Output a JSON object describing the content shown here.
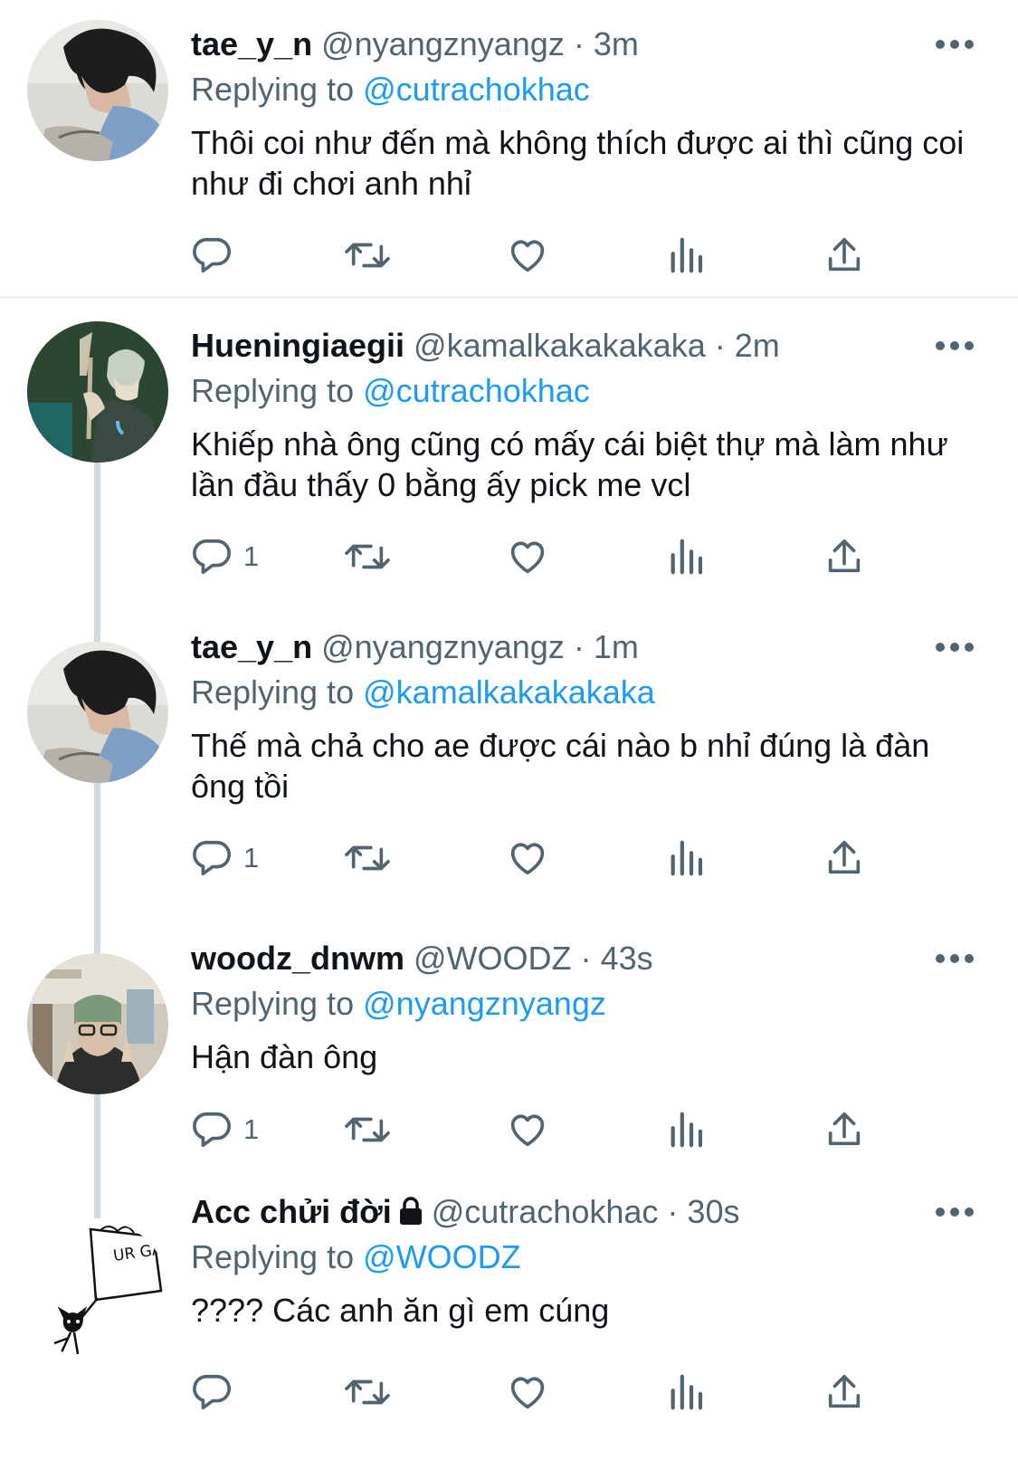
{
  "tweets": [
    {
      "name": "tae_y_n",
      "handle": "@nyangznyangz",
      "separator": "·",
      "time": "3m",
      "replying_label": "Replying to",
      "replying_to": "@cutrachokhac",
      "text": "Thôi coi như đến mà không thích được ai thì cũng coi như đi chơi anh nhỉ",
      "reply_count": ""
    },
    {
      "name": "Hueningiaegii",
      "handle": "@kamalkakakakaka",
      "separator": "·",
      "time": "2m",
      "replying_label": "Replying to",
      "replying_to": "@cutrachokhac",
      "text": "Khiếp nhà ông cũng có mấy cái biệt thự mà làm như lần đầu thấy 0 bằng ấy pick me vcl",
      "reply_count": "1"
    },
    {
      "name": "tae_y_n",
      "handle": "@nyangznyangz",
      "separator": "·",
      "time": "1m",
      "replying_label": "Replying to",
      "replying_to": "@kamalkakakakaka",
      "text": "Thế mà chả cho ae được cái nào b nhỉ đúng là đàn ông tồi",
      "reply_count": "1"
    },
    {
      "name": "woodz_dnwm",
      "handle": "@WOODZ",
      "separator": "·",
      "time": "43s",
      "replying_label": "Replying to",
      "replying_to": "@nyangznyangz",
      "text": "Hận đàn ông",
      "reply_count": "1"
    },
    {
      "name": "Acc chửi đời",
      "handle": "@cutrachokhac",
      "separator": "·",
      "time": "30s",
      "replying_label": "Replying to",
      "replying_to": "@WOODZ",
      "text": "???? Các anh ăn gì em cúng",
      "reply_count": "",
      "avatar_sign_text": "UR GAY."
    }
  ],
  "icons": {
    "reply": "speech-bubble-icon",
    "retweet": "retweet-arrows-icon",
    "like": "heart-icon",
    "views": "bar-chart-icon",
    "share": "upload-icon",
    "more": "ellipsis-icon",
    "protected": "lock-icon"
  },
  "colors": {
    "name": "#0f1419",
    "secondary": "#536471",
    "link": "#1d9bf0",
    "thread_line": "#cfd9de",
    "divider": "#eff3f4"
  }
}
